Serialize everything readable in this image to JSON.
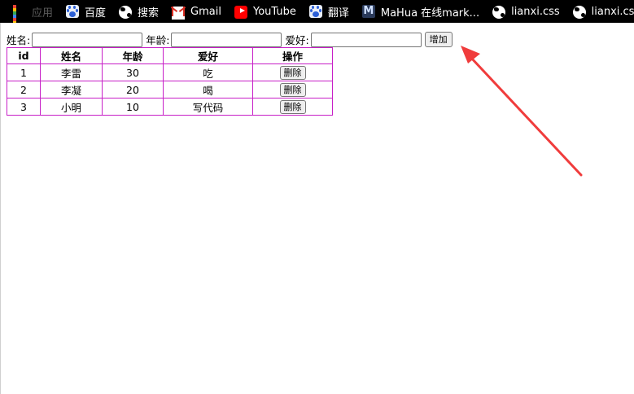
{
  "bookmarks": {
    "apps_label": "应用",
    "items": [
      {
        "label": "百度",
        "icon": "baidu-paw-icon"
      },
      {
        "label": "搜索",
        "icon": "globe-icon"
      },
      {
        "label": "Gmail",
        "icon": "gmail-icon"
      },
      {
        "label": "YouTube",
        "icon": "youtube-icon"
      },
      {
        "label": "翻译",
        "icon": "baidu-paw-icon"
      },
      {
        "label": "MaHua 在线mark...",
        "icon": "mahua-icon"
      },
      {
        "label": "lianxi.css",
        "icon": "globe-icon"
      },
      {
        "label": "lianxi.css",
        "icon": "globe-icon"
      }
    ]
  },
  "form": {
    "name_label": "姓名:",
    "age_label": "年龄:",
    "hobby_label": "爱好:",
    "name_value": "",
    "age_value": "",
    "hobby_value": "",
    "add_button": "增加"
  },
  "table": {
    "headers": [
      "id",
      "姓名",
      "年龄",
      "爱好",
      "操作"
    ],
    "rows": [
      {
        "id": "1",
        "name": "李雷",
        "age": "30",
        "hobby": "吃",
        "action": "删除"
      },
      {
        "id": "2",
        "name": "李凝",
        "age": "20",
        "hobby": "喝",
        "action": "删除"
      },
      {
        "id": "3",
        "name": "小明",
        "age": "10",
        "hobby": "写代码",
        "action": "删除"
      }
    ]
  },
  "colors": {
    "bookmarks_bg": "#000000",
    "table_border": "#c71fc7",
    "arrow": "#f03c3c"
  }
}
